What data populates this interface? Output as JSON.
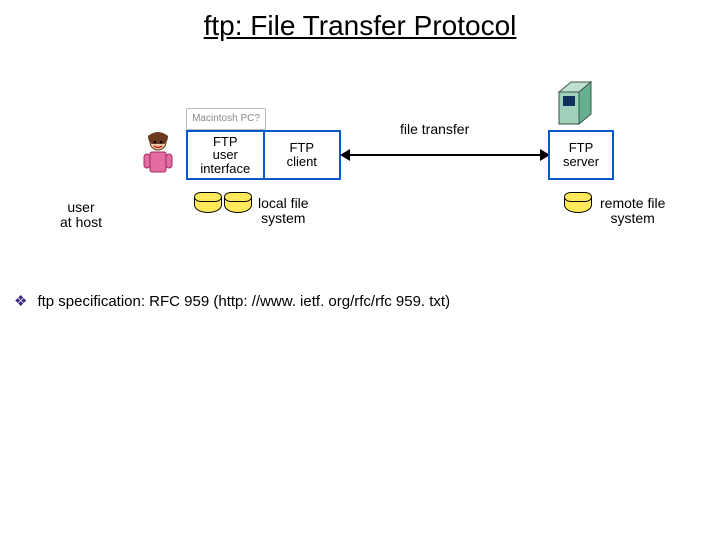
{
  "title": "ftp: File Transfer Protocol",
  "diagram": {
    "user_at_host": "user\nat host",
    "monitor_label": "Macintosh PC?",
    "box_left": "FTP\nuser\ninterface",
    "box_right": "FTP\nclient",
    "file_transfer": "file transfer",
    "server_box": "FTP\nserver",
    "local_fs": "local file\nsystem",
    "remote_fs": "remote file\nsystem"
  },
  "bullet": "ftp specification: RFC 959 (http: //www. ietf. org/rfc/rfc 959. txt)"
}
